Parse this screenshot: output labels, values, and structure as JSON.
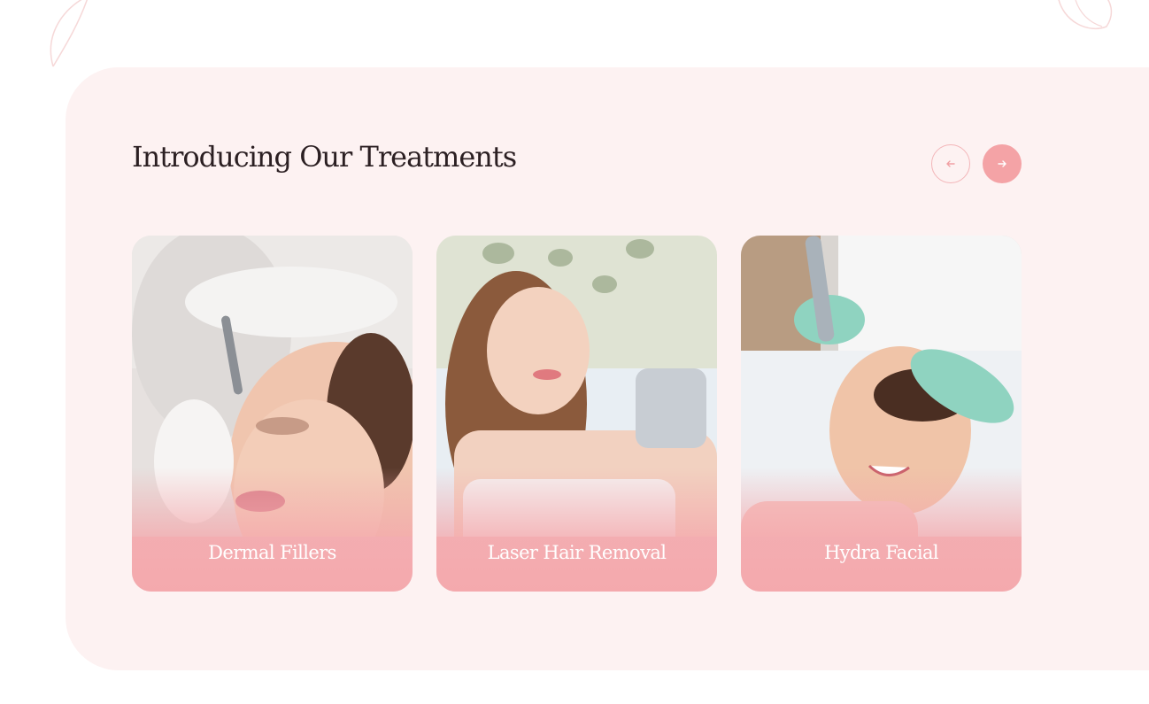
{
  "section": {
    "title": "Introducing Our Treatments"
  },
  "navigation": {
    "prev_icon": "arrow-left-icon",
    "next_icon": "arrow-right-icon"
  },
  "treatments": [
    {
      "label": "Dermal Fillers"
    },
    {
      "label": "Laser Hair Removal"
    },
    {
      "label": "Hydra Facial"
    }
  ],
  "colors": {
    "accent": "#f4a3a6",
    "section_bg": "#fdf2f2",
    "title": "#2b1f22"
  }
}
